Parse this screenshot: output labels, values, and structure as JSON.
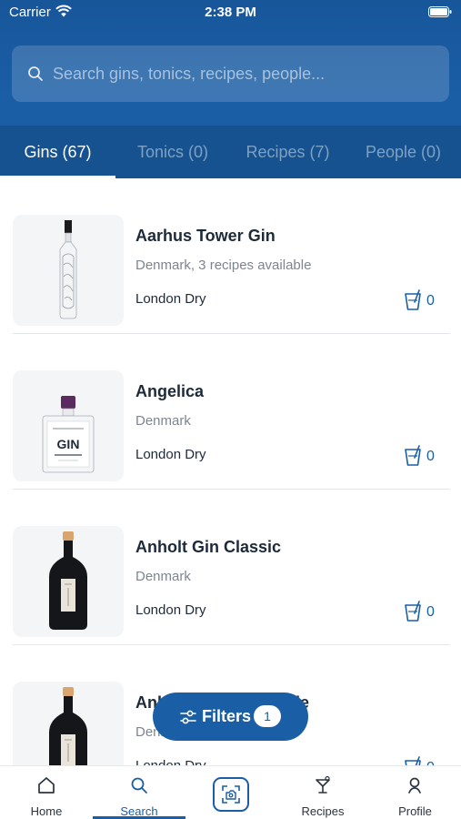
{
  "status": {
    "carrier": "Carrier",
    "time": "2:38 PM"
  },
  "search": {
    "placeholder": "Search gins, tonics, recipes, people..."
  },
  "tabs": [
    {
      "label": "Gins (67)",
      "active": true
    },
    {
      "label": "Tonics (0)",
      "active": false
    },
    {
      "label": "Recipes (7)",
      "active": false
    },
    {
      "label": "People (0)",
      "active": false
    }
  ],
  "gins": [
    {
      "name": "Aarhus Tower Gin",
      "sub": "Denmark, 3 recipes available",
      "style": "London Dry",
      "count": "0",
      "bottle": "clear-tall"
    },
    {
      "name": "Angelica",
      "sub": "Denmark",
      "style": "London Dry",
      "count": "0",
      "bottle": "clear-square"
    },
    {
      "name": "Anholt Gin Classic",
      "sub": "Denmark",
      "style": "London Dry",
      "count": "0",
      "bottle": "dark-round"
    },
    {
      "name": "Anholt Gin Marmalade",
      "sub": "Denmark",
      "style": "London Dry",
      "count": "0",
      "bottle": "dark-round"
    }
  ],
  "filters": {
    "label": "Filters",
    "badge": "1"
  },
  "nav": {
    "home": "Home",
    "search": "Search",
    "recipes": "Recipes",
    "profile": "Profile"
  },
  "colors": {
    "brand": "#1a5ea6",
    "header_dark": "#15528f"
  }
}
